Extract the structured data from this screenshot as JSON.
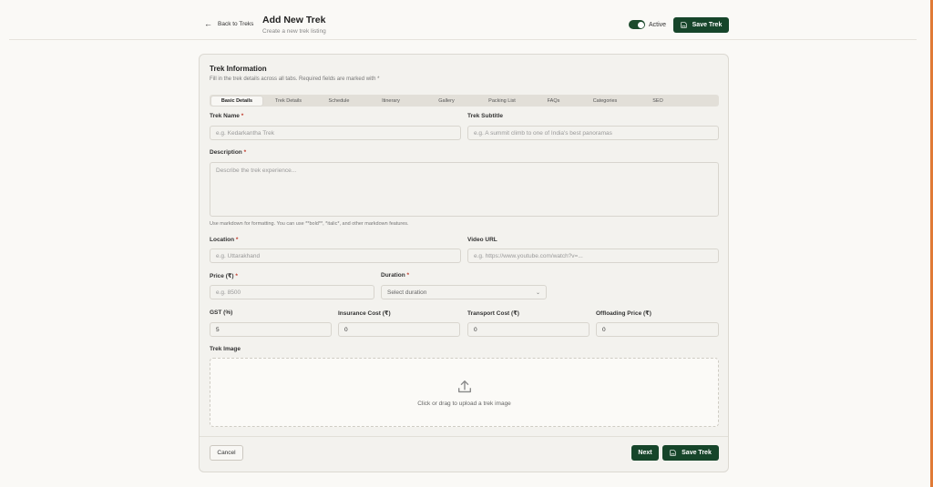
{
  "header": {
    "back_label": "Back to Treks",
    "title": "Add New Trek",
    "subtitle": "Create a new trek listing",
    "active_label": "Active",
    "active": true,
    "save_label": "Save Trek"
  },
  "card": {
    "title": "Trek Information",
    "subtitle": "Fill in the trek details across all tabs. Required fields are marked with *"
  },
  "tabs": [
    "Basic Details",
    "Trek Details",
    "Schedule",
    "Itinerary",
    "Gallery",
    "Packing List",
    "FAQs",
    "Categories",
    "SEO"
  ],
  "active_tab": "Basic Details",
  "form": {
    "trek_name": {
      "label": "Trek Name",
      "placeholder": "e.g. Kedarkantha Trek",
      "value": ""
    },
    "trek_subtitle": {
      "label": "Trek Subtitle",
      "placeholder": "e.g. A summit climb to one of India's best panoramas",
      "value": ""
    },
    "description": {
      "label": "Description",
      "placeholder": "Describe the trek experience...",
      "hint": "Use markdown for formatting. You can use **bold**, *italic*, and other markdown features."
    },
    "location": {
      "label": "Location",
      "placeholder": "e.g. Uttarakhand",
      "value": ""
    },
    "video_url": {
      "label": "Video URL",
      "placeholder": "e.g. https://www.youtube.com/watch?v=...",
      "value": ""
    },
    "price": {
      "label": "Price (₹)",
      "placeholder": "e.g. 8500",
      "value": ""
    },
    "duration": {
      "label": "Duration",
      "selected": "Select duration"
    },
    "gst": {
      "label": "GST (%)",
      "value": "5"
    },
    "insurance": {
      "label": "Insurance Cost (₹)",
      "value": "0"
    },
    "transport": {
      "label": "Transport Cost (₹)",
      "value": "0"
    },
    "offloading": {
      "label": "Offloading Price (₹)",
      "value": "0"
    },
    "trek_image": {
      "label": "Trek Image",
      "upload_text": "Click or drag to upload a trek image"
    },
    "required_mark": "*"
  },
  "footer": {
    "cancel_label": "Cancel",
    "next_label": "Next",
    "save_label": "Save Trek"
  },
  "colors": {
    "primary": "#16452a",
    "accent_scroll": "#e07a36",
    "required": "#c03a2b"
  }
}
